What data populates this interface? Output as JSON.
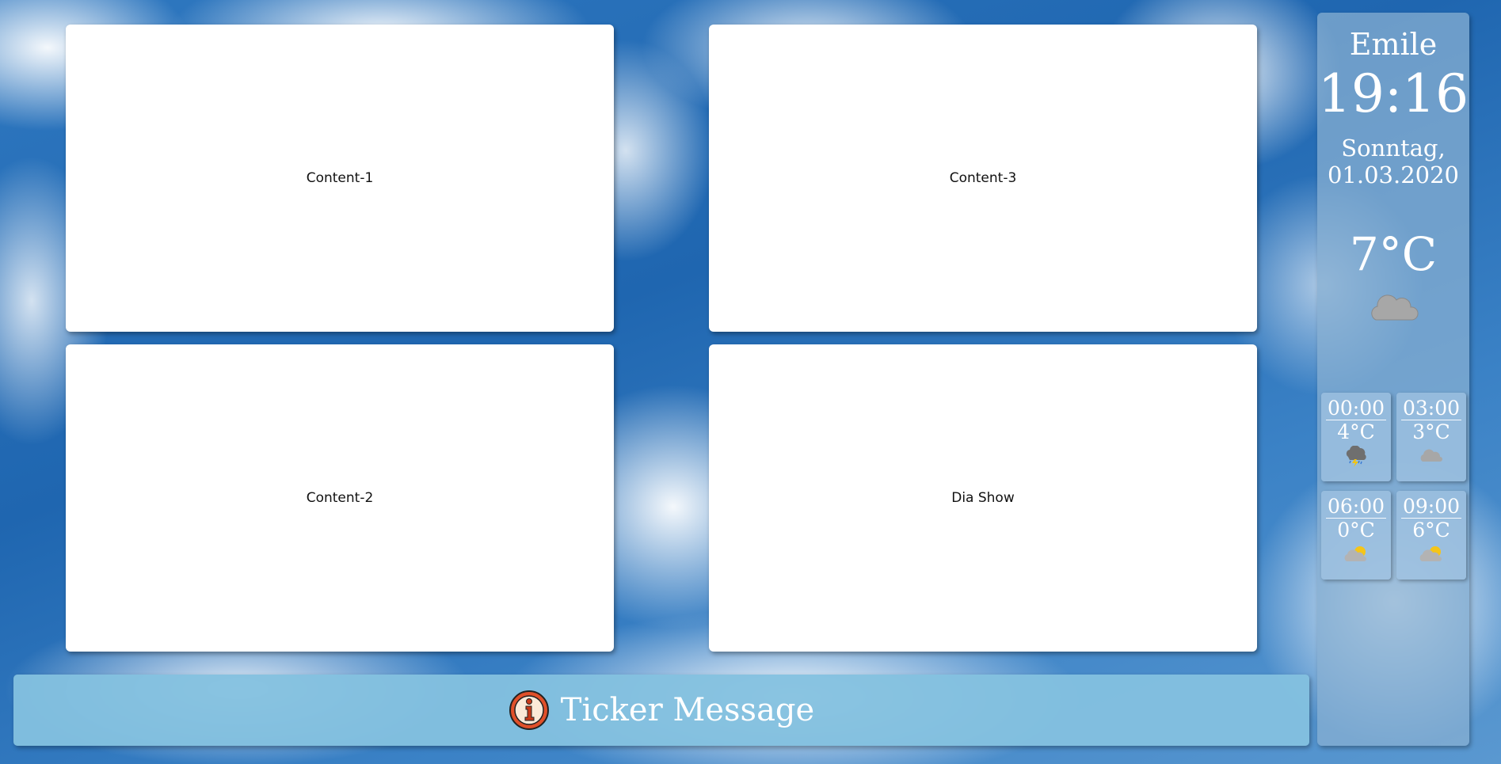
{
  "panels": [
    {
      "label": "Content-1"
    },
    {
      "label": "Content-2"
    },
    {
      "label": "Content-3"
    },
    {
      "label": "Dia Show"
    }
  ],
  "ticker": {
    "message": "Ticker Message",
    "icon": "info-icon",
    "icon_color": "#e0502a"
  },
  "sidebar": {
    "user_name": "Emile",
    "time": "19:16",
    "weekday": "Sonntag,",
    "date": "01.03.2020",
    "current_temp": "7°C",
    "current_icon": "cloud-icon",
    "forecast": [
      {
        "time": "00:00",
        "temp": "4°C",
        "icon": "thunderstorm-icon"
      },
      {
        "time": "03:00",
        "temp": "3°C",
        "icon": "cloud-icon"
      },
      {
        "time": "06:00",
        "temp": "0°C",
        "icon": "partly-cloudy-icon"
      },
      {
        "time": "09:00",
        "temp": "6°C",
        "icon": "partly-cloudy-icon"
      }
    ]
  }
}
